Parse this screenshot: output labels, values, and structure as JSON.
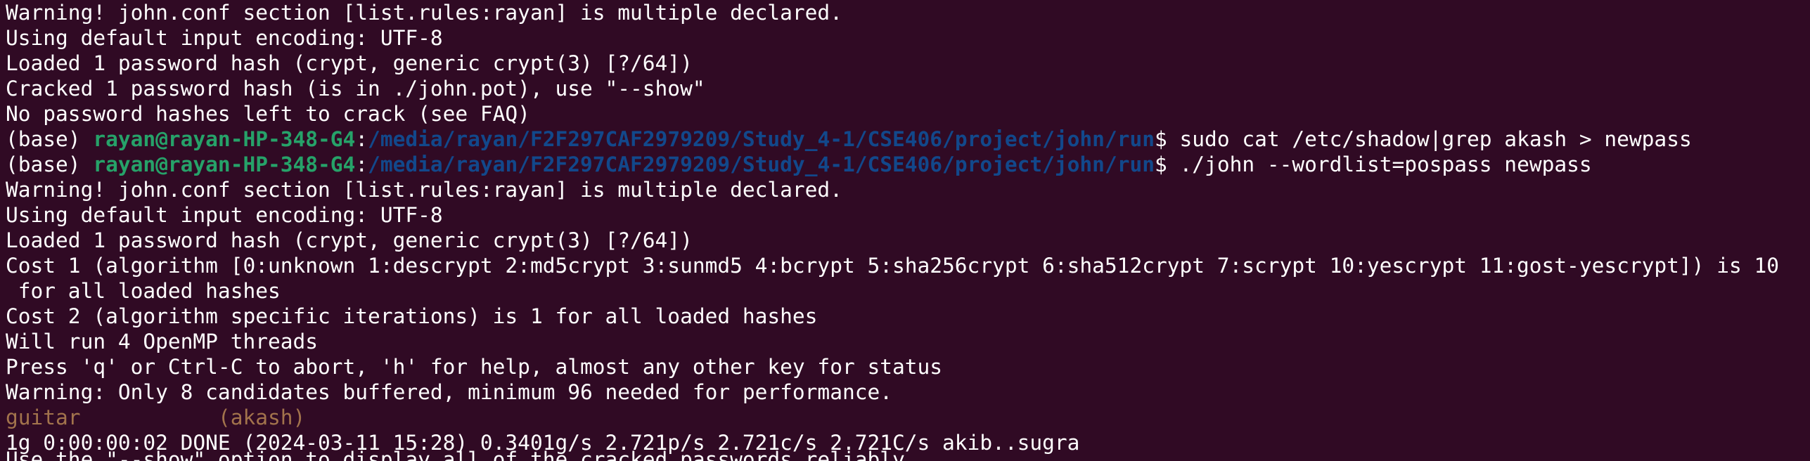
{
  "terminal": {
    "colors": {
      "background": "#300a24",
      "text": "#ffffff",
      "prompt_user": "#26a269",
      "prompt_path": "#12488b",
      "cracked": "#a2734c"
    },
    "lines": {
      "l1": "Warning! john.conf section [list.rules:rayan] is multiple declared.",
      "l2": "Using default input encoding: UTF-8",
      "l3": "Loaded 1 password hash (crypt, generic crypt(3) [?/64])",
      "l4": "Cracked 1 password hash (is in ./john.pot), use \"--show\"",
      "l5": "No password hashes left to crack (see FAQ)",
      "l8": "Warning! john.conf section [list.rules:rayan] is multiple declared.",
      "l9": "Using default input encoding: UTF-8",
      "l10": "Loaded 1 password hash (crypt, generic crypt(3) [?/64])",
      "l11": "Cost 1 (algorithm [0:unknown 1:descrypt 2:md5crypt 3:sunmd5 4:bcrypt 5:sha256crypt 6:sha512crypt 7:scrypt 10:yescrypt 11:gost-yescrypt]) is 10",
      "l12": " for all loaded hashes",
      "l13": "Cost 2 (algorithm specific iterations) is 1 for all loaded hashes",
      "l14": "Will run 4 OpenMP threads",
      "l15": "Press 'q' or Ctrl-C to abort, 'h' for help, almost any other key for status",
      "l16": "Warning: Only 8 candidates buffered, minimum 96 needed for performance.",
      "l18": "1g 0:00:00:02 DONE (2024-03-11 15:28) 0.3401g/s 2.721p/s 2.721c/s 2.721C/s akib..sugra",
      "l19": "Use the \"--show\" option to display all of the cracked passwords reliably"
    },
    "prompt": {
      "env": "(base) ",
      "user_host": "rayan@rayan-HP-348-G4",
      "colon": ":",
      "path": "/media/rayan/F2F297CAF2979209/Study_4-1/CSE406/project/john/run",
      "dollar": "$ "
    },
    "commands": {
      "c1": "sudo cat /etc/shadow|grep akash > newpass",
      "c2": "./john --wordlist=pospass newpass"
    },
    "cracked": {
      "password": "guitar",
      "spacing": "           ",
      "account": "(akash)"
    }
  }
}
